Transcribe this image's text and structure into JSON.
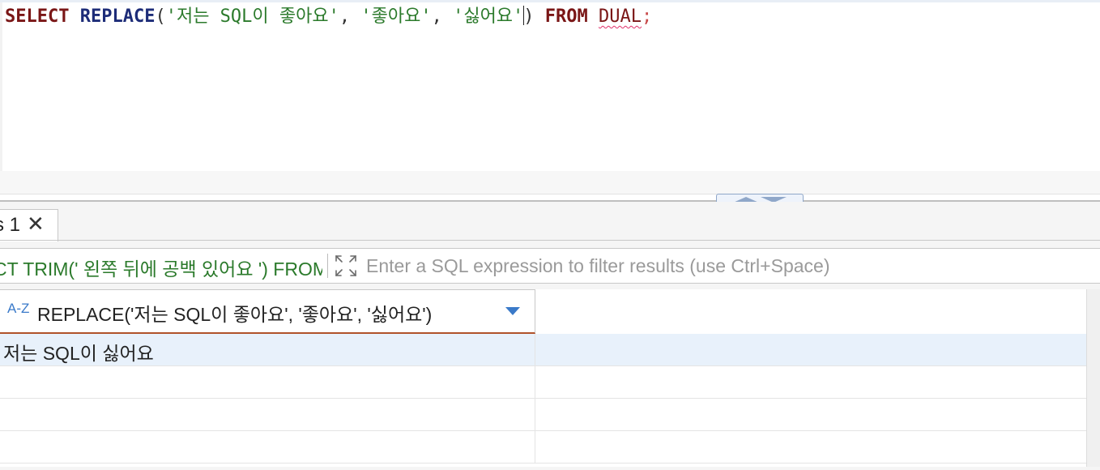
{
  "editor": {
    "tokens": [
      {
        "text": "SELECT",
        "kind": "kw"
      },
      {
        "text": " ",
        "kind": "punc"
      },
      {
        "text": "REPLACE",
        "kind": "fn"
      },
      {
        "text": "(",
        "kind": "punc"
      },
      {
        "text": "'저는 SQL이 좋아요'",
        "kind": "str"
      },
      {
        "text": ", ",
        "kind": "punc"
      },
      {
        "text": "'좋아요'",
        "kind": "str"
      },
      {
        "text": ", ",
        "kind": "punc"
      },
      {
        "text": "'싫어요'",
        "kind": "str"
      },
      {
        "text": "caret",
        "kind": "caret"
      },
      {
        "text": ") ",
        "kind": "punc"
      },
      {
        "text": "FROM",
        "kind": "kw"
      },
      {
        "text": " ",
        "kind": "punc"
      },
      {
        "text": "DUAL",
        "kind": "ident-err"
      },
      {
        "text": ";",
        "kind": "semi"
      }
    ]
  },
  "results": {
    "tab": {
      "label": "s 1",
      "close_icon": "close-icon"
    },
    "filter": {
      "query_text": "CT TRIM(' 왼쪽 뒤에 공백 있어요 ') FROM DUAL",
      "expand_icon": "expand-icon",
      "placeholder": "Enter a SQL expression to filter results (use Ctrl+Space)"
    },
    "columns": [
      {
        "type_icon_text": "A-Z",
        "title": "REPLACE('저는 SQL이 좋아요', '좋아요', '싫어요')",
        "sort_icon": "sort-dropdown-icon"
      }
    ],
    "rows": [
      {
        "cells": [
          "저는 SQL이 싫어요"
        ],
        "selected": true
      },
      {
        "cells": [
          ""
        ],
        "selected": false
      },
      {
        "cells": [
          ""
        ],
        "selected": false
      },
      {
        "cells": [
          ""
        ],
        "selected": false
      }
    ]
  },
  "colors": {
    "keyword": "#7a1616",
    "function": "#1d2c78",
    "string": "#2b7a2b",
    "selected_row": "#e8f1fb",
    "header_accent": "#b0522a",
    "icon_blue": "#3a7ac9"
  }
}
